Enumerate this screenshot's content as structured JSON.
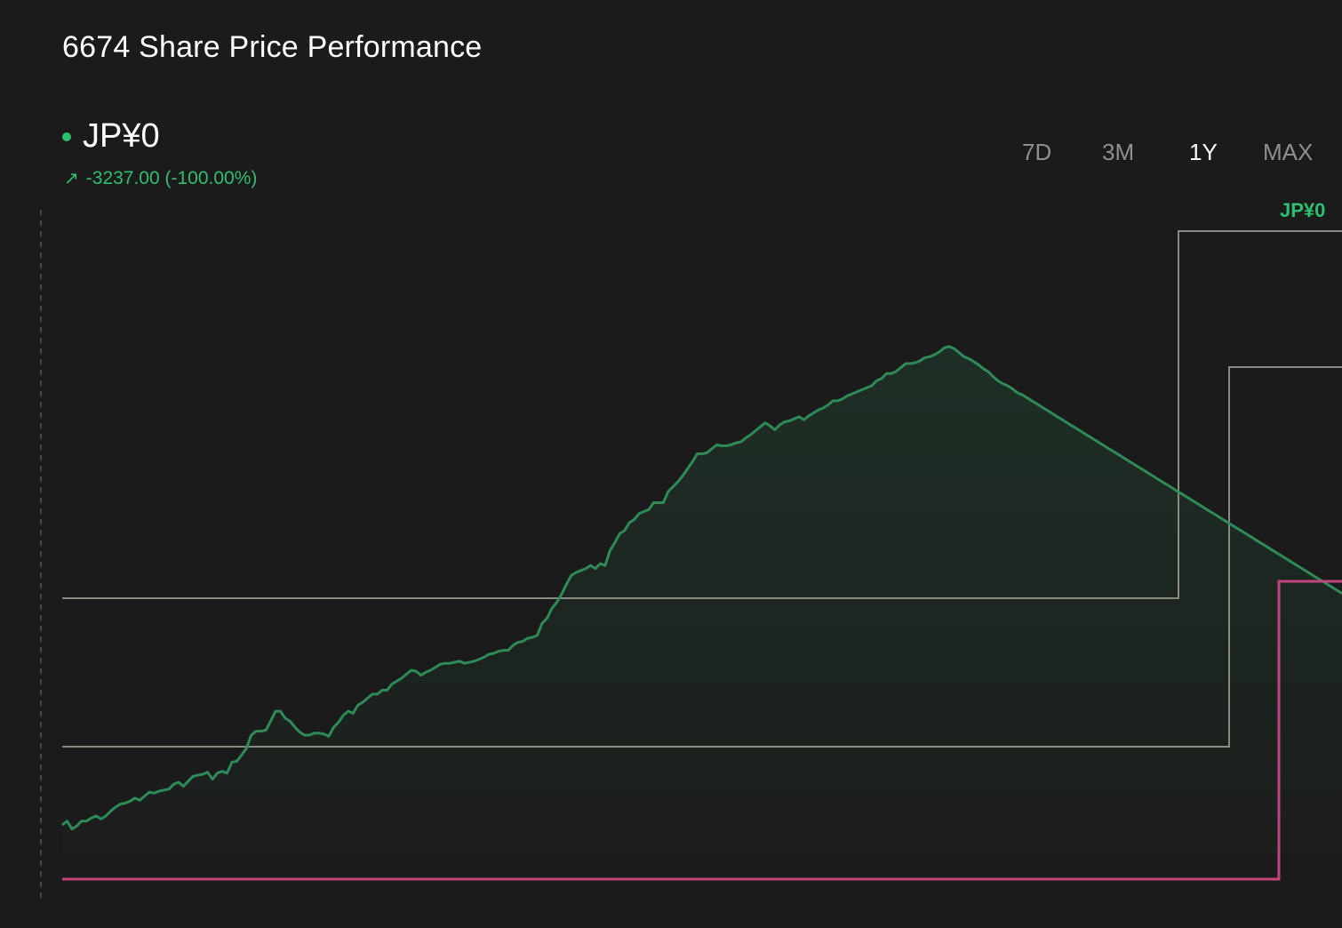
{
  "header": {
    "title": "6674 Share Price Performance",
    "price": "JP¥0",
    "change": "-3237.00 (-100.00%)",
    "change_icon": "arrow-up-right-icon"
  },
  "ranges": [
    {
      "label": "7D",
      "active": false
    },
    {
      "label": "3M",
      "active": false
    },
    {
      "label": "1Y",
      "active": true
    },
    {
      "label": "MAX",
      "active": false
    }
  ],
  "colors": {
    "background": "#1b1b1b",
    "line": "#2e8b57",
    "positive_text": "#2fbf71",
    "marker_box": "#8a8a80",
    "step_line": "#c0457f"
  },
  "chart_data": {
    "type": "line",
    "title": "",
    "xlabel": "",
    "ylabel": "",
    "grid": false,
    "ylim": [
      0,
      100
    ],
    "cropped_label": "JP¥0",
    "series": [
      {
        "values": [
          5.23,
          5.95,
          4.48,
          5.03,
          5.95,
          5.95,
          6.51,
          6.88,
          6.33,
          6.88,
          7.79,
          8.52,
          9.08,
          9.26,
          9.63,
          10.18,
          9.81,
          10.55,
          11.29,
          11.1,
          11.47,
          11.65,
          11.84,
          12.75,
          13.12,
          12.38,
          13.31,
          14.22,
          14.41,
          14.59,
          14.96,
          13.67,
          14.78,
          15.14,
          14.78,
          16.81,
          16.99,
          18.1,
          19.38,
          21.8,
          22.53,
          22.53,
          22.71,
          24.37,
          26.21,
          26.21,
          24.92,
          24.37,
          23.27,
          22.35,
          21.8,
          21.8,
          22.17,
          22.17,
          21.98,
          21.61,
          23.27,
          24.18,
          25.48,
          26.21,
          25.84,
          27.33,
          27.87,
          28.62,
          29.36,
          29.36,
          30.09,
          30.09,
          31.19,
          31.75,
          32.3,
          33.03,
          33.77,
          33.59,
          32.85,
          33.4,
          33.77,
          34.32,
          34.88,
          35.05,
          35.05,
          35.24,
          35.42,
          35.05,
          35.24,
          35.42,
          35.79,
          36.16,
          36.7,
          36.89,
          37.26,
          37.45,
          37.45,
          38.36,
          38.92,
          39.1,
          39.65,
          39.83,
          40.21,
          42.42,
          43.34,
          45.17,
          46.28,
          47.75,
          49.58,
          51.24,
          51.8,
          52.16,
          52.53,
          53.08,
          52.53,
          53.45,
          53.08,
          55.83,
          57.31,
          58.97,
          59.52,
          60.99,
          61.55,
          62.65,
          63.03,
          63.39,
          64.68,
          64.68,
          64.68,
          66.71,
          67.62,
          68.53,
          69.63,
          70.92,
          72.21,
          73.69,
          73.69,
          73.87,
          74.61,
          75.35,
          75.16,
          75.16,
          75.35,
          75.71,
          75.89,
          76.63,
          77.19,
          77.93,
          78.66,
          79.4,
          78.84,
          78.12,
          79.02,
          79.58,
          79.76,
          80.13,
          80.5,
          79.96,
          80.68,
          81.23,
          81.78,
          82.15,
          82.7,
          83.46,
          83.46,
          83.84,
          84.39,
          84.76,
          85.14,
          85.51,
          85.88,
          86.25,
          87.18,
          87.55,
          88.48,
          88.48,
          88.85,
          89.58,
          90.32,
          90.32,
          90.5,
          90.87,
          91.42,
          91.61,
          91.98,
          92.53,
          93.27,
          93.46,
          93.08,
          92.34,
          91.61,
          91.24,
          90.69,
          90.13,
          89.39,
          88.85,
          87.93,
          87.18,
          86.62,
          86.25,
          85.69,
          84.96,
          84.59,
          84.03,
          83.47,
          82.92,
          82.36,
          81.8,
          81.25,
          80.69,
          80.13,
          79.58,
          79.02,
          78.47,
          77.92,
          77.36,
          76.8,
          76.25,
          75.69,
          75.14,
          74.58,
          74.03,
          73.47,
          72.92,
          72.36,
          71.81,
          71.25,
          70.7,
          70.14,
          69.59,
          69.03,
          68.48,
          67.92,
          67.37,
          66.81,
          66.26,
          65.7,
          65.15,
          64.59,
          64.04,
          63.48,
          62.93,
          62.37,
          61.82,
          61.26,
          60.71,
          60.15,
          59.6,
          59.04,
          58.49,
          57.93,
          57.38,
          56.82,
          56.27,
          55.71,
          55.16,
          54.6,
          54.05,
          53.49,
          52.94,
          52.38,
          51.83,
          51.27,
          50.72,
          50.16,
          49.61,
          49.05,
          48.5,
          47.94
        ]
      }
    ]
  }
}
